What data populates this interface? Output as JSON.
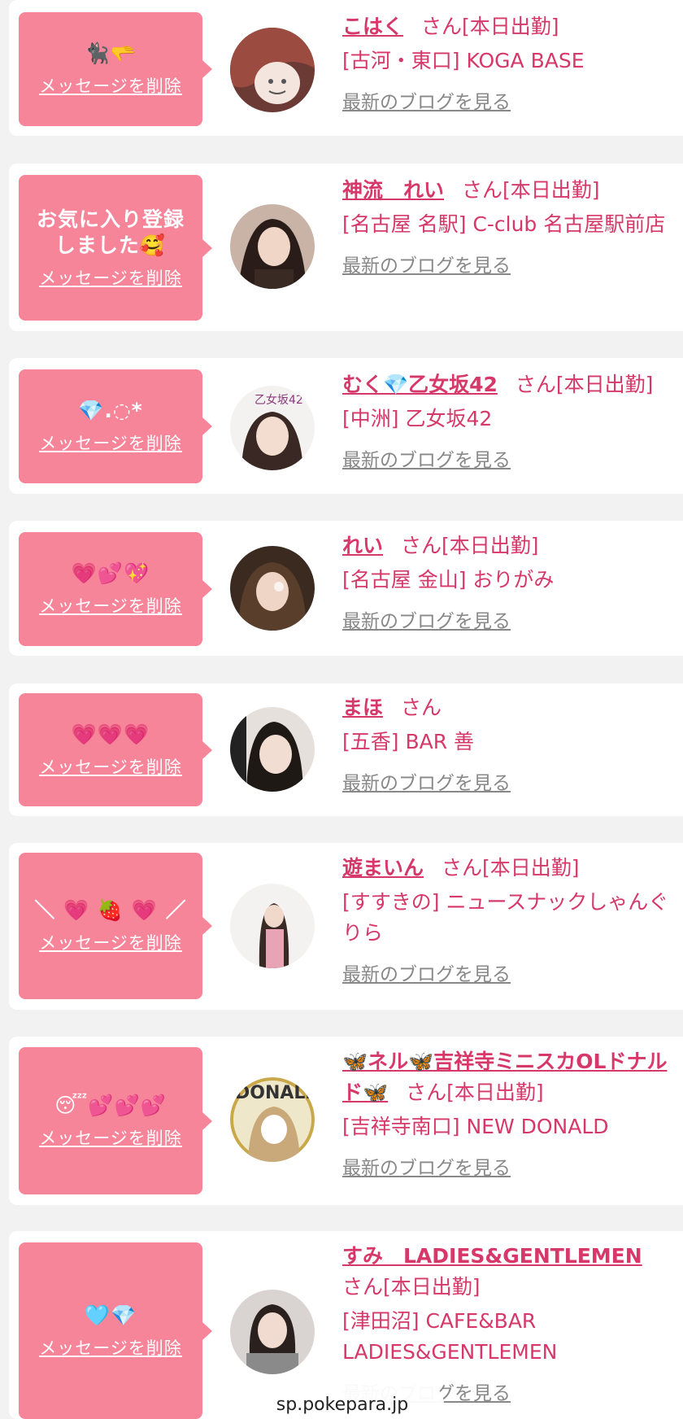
{
  "delete_label": "メッセージを削除",
  "blog_label": "最新のブログを見る",
  "entries": [
    {
      "message": "🐈‍⬛🫳",
      "name": "こはく",
      "san": "さん[本日出勤]",
      "shop": "[古河・東口] KOGA BASE"
    },
    {
      "message": "お気に入り登録しました🥰",
      "name": "神流　れい",
      "san": "さん[本日出勤]",
      "shop": "[名古屋 名駅] C-club 名古屋駅前店"
    },
    {
      "message": "💎.◌*",
      "name": "むく💎乙女坂42",
      "san": "さん[本日出勤]",
      "shop": "[中洲] 乙女坂42"
    },
    {
      "message": "💗💕💖",
      "name": "れい",
      "san": "さん[本日出勤]",
      "shop": "[名古屋 金山] おりがみ"
    },
    {
      "message": "💗💗💗",
      "name": "まほ",
      "san": "さん",
      "shop": "[五香] BAR 善"
    },
    {
      "message": "＼ 💗 🍓 💗 ／",
      "name": "遊まいん",
      "san": "さん[本日出勤]",
      "shop": "[すすきの] ニュースナックしゃんぐりら"
    },
    {
      "message": "😴💕💕💕",
      "name": "🦋ネル🦋吉祥寺ミニスカOLドナルド🦋",
      "san": "さん[本日出勤]",
      "shop": "[吉祥寺南口] NEW DONALD"
    },
    {
      "message": "🩵💎",
      "name": "すみ　LADIES&GENTLEMEN",
      "san": "さん[本日出勤]",
      "shop": "[津田沼] CAFE&BAR LADIES&GENTLEMEN"
    }
  ],
  "url_bar": "sp.pokepara.jp"
}
